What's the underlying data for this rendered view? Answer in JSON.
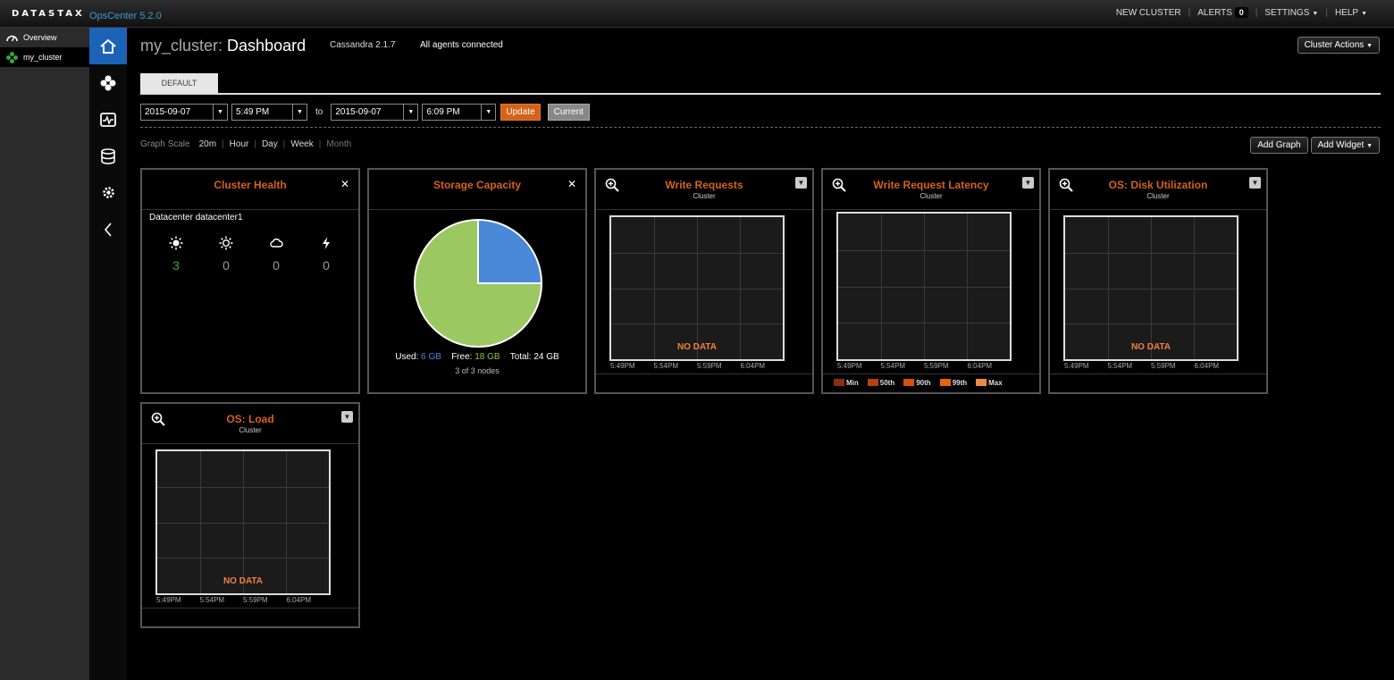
{
  "app": {
    "logo_text": "DATASTAX",
    "product": "OpsCenter 5.2.0",
    "nav": {
      "new_cluster": "NEW CLUSTER",
      "alerts": "ALERTS",
      "alerts_count": "0",
      "settings": "SETTINGS",
      "help": "HELP"
    }
  },
  "sidebar": {
    "items": [
      {
        "label": "Overview",
        "icon": "gauge-icon"
      },
      {
        "label": "my_cluster",
        "icon": "cluster-icon"
      }
    ]
  },
  "header": {
    "cluster_name": "my_cluster:",
    "page": "Dashboard",
    "version": "Cassandra 2.1.7",
    "agents": "All agents connected",
    "cluster_actions": "Cluster Actions"
  },
  "tabs": [
    "DEFAULT"
  ],
  "time_range": {
    "from_date": "2015-09-07",
    "from_time": "5:49 PM",
    "to_label": "to",
    "to_date": "2015-09-07",
    "to_time": "6:09 PM",
    "update": "Update",
    "current": "Current"
  },
  "graph_scale": {
    "label": "Graph Scale",
    "options": [
      "20m",
      "Hour",
      "Day",
      "Week",
      "Month"
    ]
  },
  "actions": {
    "add_graph": "Add Graph",
    "add_widget": "Add Widget"
  },
  "widgets": {
    "health": {
      "title": "Cluster Health",
      "datacenter": "Datacenter datacenter1",
      "counts": [
        "3",
        "0",
        "0",
        "0"
      ]
    },
    "storage": {
      "title": "Storage Capacity",
      "used_label": "Used:",
      "used": "6 GB",
      "free_label": "Free:",
      "free": "18 GB",
      "total_label": "Total:",
      "total": "24 GB",
      "nodes": "3 of 3 nodes",
      "used_fraction": 0.25
    },
    "write_requests": {
      "title": "Write Requests",
      "sub": "Cluster",
      "nodata": "NO DATA"
    },
    "write_latency": {
      "title": "Write Request Latency",
      "sub": "Cluster",
      "legend": [
        "Min",
        "50th",
        "90th",
        "99th",
        "Max"
      ]
    },
    "disk": {
      "title": "OS: Disk Utilization",
      "sub": "Cluster",
      "nodata": "NO DATA"
    },
    "load": {
      "title": "OS: Load",
      "sub": "Cluster",
      "nodata": "NO DATA"
    },
    "x_ticks": [
      "5:49PM",
      "5:54PM",
      "5:59PM",
      "6:04PM"
    ]
  },
  "colors": {
    "accent": "#d4621a",
    "brand_blue": "#3a9ad9",
    "used": "#4a88d8",
    "free": "#9bc861",
    "healthy": "#3aa63a",
    "legend": [
      "#8b2e10",
      "#b8400f",
      "#d4500c",
      "#e8620c",
      "#f08a40"
    ]
  }
}
